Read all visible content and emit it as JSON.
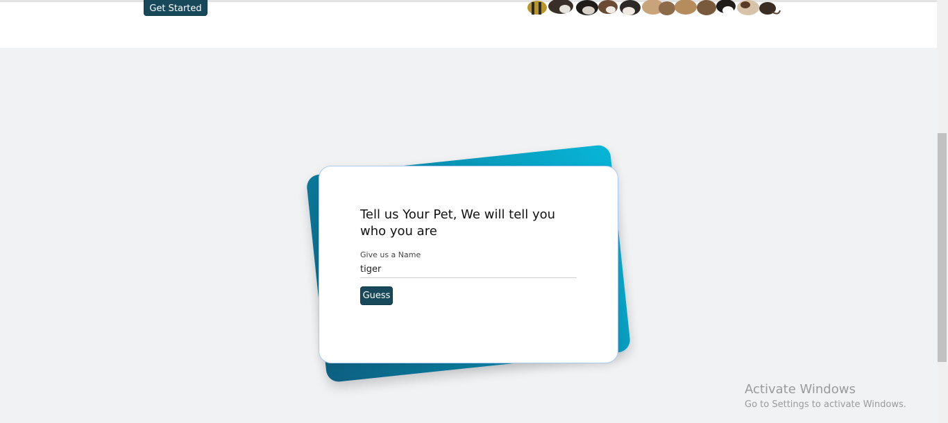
{
  "hero": {
    "get_started_label": "Get Started",
    "image_name": "pets-row-image"
  },
  "card": {
    "title": "Tell us Your Pet, We will tell you who you are",
    "field_label": "Give us a Name",
    "input_value": "tiger",
    "guess_label": "Guess"
  },
  "watermark": {
    "title": "Activate Windows",
    "subtitle": "Go to Settings to activate Windows."
  },
  "colors": {
    "button": "#18495a",
    "background": "#f1f2f4",
    "card_back_start": "#0d5f80",
    "card_back_end": "#07b6d8"
  }
}
